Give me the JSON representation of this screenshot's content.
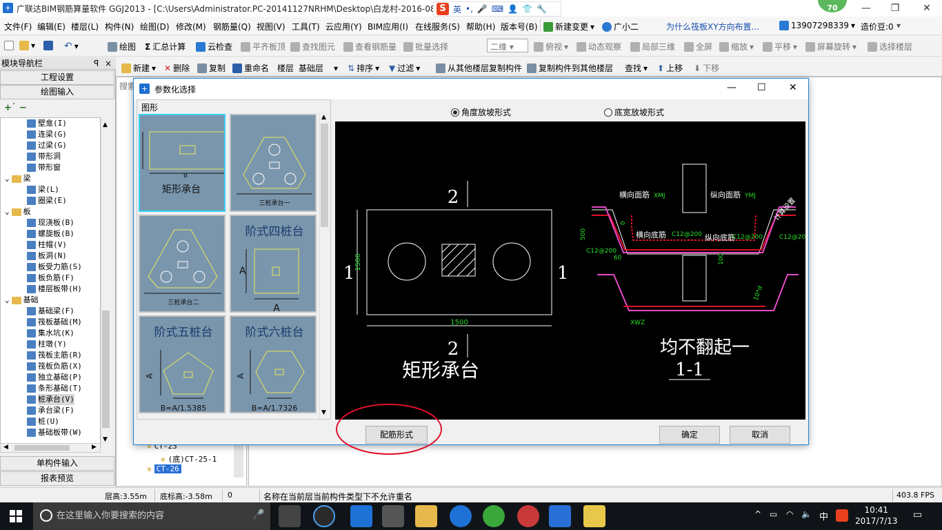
{
  "titlebar": {
    "title": "广联达BIM钢筋算量软件 GGJ2013 - [C:\\Users\\Administrator.PC-20141127NRHM\\Desktop\\白龙村-2016-08-",
    "ime_english": "英",
    "score": "70"
  },
  "menu": [
    "文件(F)",
    "编辑(E)",
    "楼层(L)",
    "构件(N)",
    "绘图(D)",
    "修改(M)",
    "钢筋量(Q)",
    "视图(V)",
    "工具(T)",
    "云应用(Y)",
    "BIM应用(I)",
    "在线服务(S)",
    "帮助(H)",
    "版本号(B)",
    "新建变更",
    "广小二",
    "为什么筏板XY方向布置...",
    "13907298339",
    "造价豆:0"
  ],
  "toolbar1": {
    "draw": "绘图",
    "summary": "汇总计算",
    "cloud_check": "云检查",
    "align_top": "平齐板顶",
    "find_elem": "查找图元",
    "view_rebar": "查看钢筋量",
    "batch_select": "批量选择",
    "view_mode": "二维",
    "top_view": "俯视",
    "dynamic_view": "动态观察",
    "local_3d": "局部三维",
    "fullscreen": "全屏",
    "zoom": "缩放",
    "pan": "平移",
    "rotate": "屏幕旋转",
    "select_floor": "选择楼层"
  },
  "toolbar2": {
    "new": "新建",
    "delete": "删除",
    "copy": "复制",
    "rename": "重命名",
    "floor_label": "楼层",
    "floor_value": "基础层",
    "sort": "排序",
    "filter": "过滤",
    "copy_from": "从其他楼层复制构件",
    "copy_to": "复制构件到其他楼层",
    "find": "查找",
    "move_up": "上移",
    "move_down": "下移"
  },
  "leftpanel": {
    "title": "模块导航栏",
    "pin": "ꟼ",
    "project_settings": "工程设置",
    "drawing_input": "绘图输入",
    "single_input": "单构件输入",
    "report_preview": "报表预览",
    "tree": [
      {
        "label": "壁龛(I)",
        "level": 2
      },
      {
        "label": "连梁(G)",
        "level": 2
      },
      {
        "label": "过梁(G)",
        "level": 2
      },
      {
        "label": "带形洞",
        "level": 2
      },
      {
        "label": "带形窗",
        "level": 2
      },
      {
        "label": "梁",
        "level": 1
      },
      {
        "label": "梁(L)",
        "level": 2
      },
      {
        "label": "圈梁(E)",
        "level": 2
      },
      {
        "label": "板",
        "level": 1
      },
      {
        "label": "现浇板(B)",
        "level": 2
      },
      {
        "label": "螺旋板(B)",
        "level": 2
      },
      {
        "label": "柱帽(V)",
        "level": 2
      },
      {
        "label": "板洞(N)",
        "level": 2
      },
      {
        "label": "板受力筋(S)",
        "level": 2
      },
      {
        "label": "板负筋(F)",
        "level": 2
      },
      {
        "label": "楼层板带(H)",
        "level": 2
      },
      {
        "label": "基础",
        "level": 1
      },
      {
        "label": "基础梁(F)",
        "level": 2
      },
      {
        "label": "筏板基础(M)",
        "level": 2
      },
      {
        "label": "集水坑(K)",
        "level": 2
      },
      {
        "label": "柱墩(Y)",
        "level": 2
      },
      {
        "label": "筏板主筋(R)",
        "level": 2
      },
      {
        "label": "筏板负筋(X)",
        "level": 2
      },
      {
        "label": "独立基础(P)",
        "level": 2
      },
      {
        "label": "条形基础(T)",
        "level": 2
      },
      {
        "label": "桩承台(V)",
        "level": 2,
        "selected": true
      },
      {
        "label": "承台梁(F)",
        "level": 2
      },
      {
        "label": "桩(U)",
        "level": 2
      },
      {
        "label": "基础板带(W)",
        "level": 2
      }
    ]
  },
  "midpanel": {
    "search": "搜索",
    "items": [
      "CT-25",
      "(底)CT-25-1",
      "CT-26"
    ]
  },
  "dialog": {
    "title": "参数化选择",
    "group_label": "图形",
    "shapes": [
      "矩形承台",
      "三桩承台一",
      "三桩承台二",
      "阶式四桩台",
      "阶式五桩台",
      "阶式六桩台"
    ],
    "shape_formulas": {
      "five": "B=A/1.5385",
      "six": "B=A/1.7326"
    },
    "radio_angle": "角度放坡形式",
    "radio_bottom": "底宽放坡形式",
    "rebar_button": "配筋形式",
    "ok": "确定",
    "cancel": "取消",
    "preview": {
      "name": "矩形承台",
      "dim_1500": "1500",
      "section_2": "2",
      "section_1": "1",
      "no_fold": "均不翻起一",
      "section_label": "1-1",
      "h_top": "横向面筋",
      "h_top_code": "XMJ",
      "v_top": "纵向面筋",
      "v_top_code": "YMJ",
      "h_bot": "横向底筋",
      "v_bot": "纵向底筋",
      "rebar_spec": "C12@200",
      "dim_500": "500",
      "dim_100": "100",
      "dim_10d": "10*d",
      "xwz": "XWZ",
      "angle_60": "60",
      "zero": "0",
      "set_by_user": "计算设置"
    }
  },
  "statusbar": {
    "floor_height": "层高:3.55m",
    "bottom_elev": "底标高:-3.58m",
    "zero": "0",
    "message": "名称在当前层当前构件类型下不允许重名",
    "fps": "403.8 FPS"
  },
  "taskbar": {
    "search_placeholder": "在这里输入你要搜索的内容",
    "ime": "中",
    "time": "10:41",
    "date": "2017/7/13"
  },
  "colors": {
    "accent": "#0078d7",
    "preview_bg": "#000000",
    "shape_bg": "#7a96ad",
    "annotation_red": "#e0102a"
  }
}
